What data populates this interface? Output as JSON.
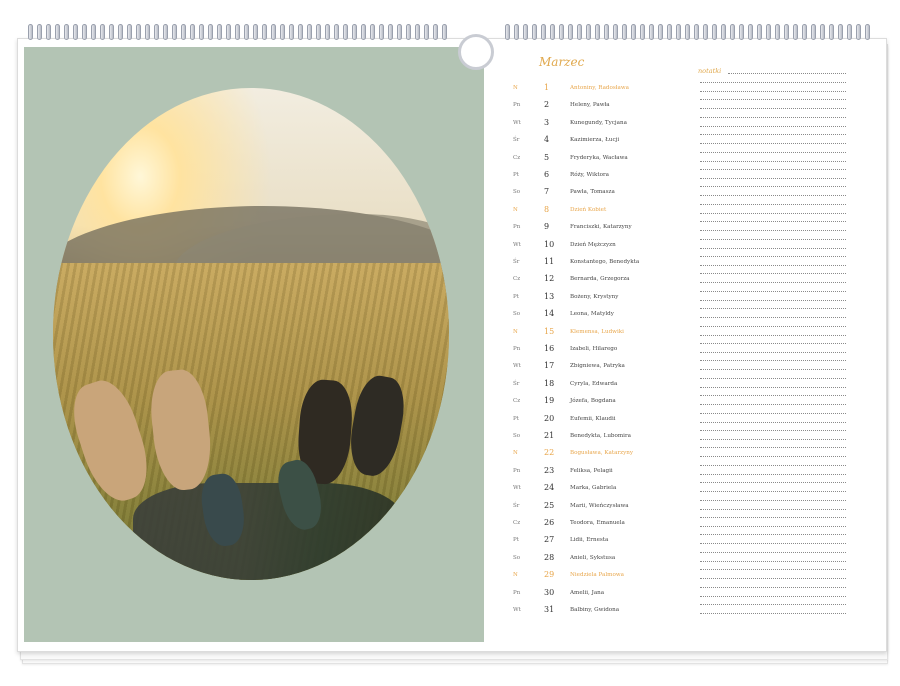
{
  "calendar": {
    "month": "Marzec",
    "notes_label": "notatki",
    "days": [
      {
        "dow": "N",
        "day": "1",
        "names": "Antoniny, Radosława",
        "sunday": true
      },
      {
        "dow": "Pn",
        "day": "2",
        "names": "Heleny, Pawła",
        "sunday": false
      },
      {
        "dow": "Wt",
        "day": "3",
        "names": "Kunegundy, Tycjana",
        "sunday": false
      },
      {
        "dow": "Śr",
        "day": "4",
        "names": "Kazimierza, Łucji",
        "sunday": false
      },
      {
        "dow": "Cz",
        "day": "5",
        "names": "Fryderyka, Wacława",
        "sunday": false
      },
      {
        "dow": "Pt",
        "day": "6",
        "names": "Róży, Wiktora",
        "sunday": false
      },
      {
        "dow": "So",
        "day": "7",
        "names": "Pawła, Tomasza",
        "sunday": false
      },
      {
        "dow": "N",
        "day": "8",
        "names": "Dzień Kobiet",
        "sunday": true
      },
      {
        "dow": "Pn",
        "day": "9",
        "names": "Franciszki, Katarzyny",
        "sunday": false
      },
      {
        "dow": "Wt",
        "day": "10",
        "names": "Dzień Mężczyzn",
        "sunday": false
      },
      {
        "dow": "Śr",
        "day": "11",
        "names": "Konstantego, Benedykta",
        "sunday": false
      },
      {
        "dow": "Cz",
        "day": "12",
        "names": "Bernarda, Grzegorza",
        "sunday": false
      },
      {
        "dow": "Pt",
        "day": "13",
        "names": "Bożeny, Krystyny",
        "sunday": false
      },
      {
        "dow": "So",
        "day": "14",
        "names": "Leona, Matyldy",
        "sunday": false
      },
      {
        "dow": "N",
        "day": "15",
        "names": "Klemensa, Ludwiki",
        "sunday": true
      },
      {
        "dow": "Pn",
        "day": "16",
        "names": "Izabeli, Hilarego",
        "sunday": false
      },
      {
        "dow": "Wt",
        "day": "17",
        "names": "Zbigniewa, Patryka",
        "sunday": false
      },
      {
        "dow": "Śr",
        "day": "18",
        "names": "Cyryla, Edwarda",
        "sunday": false
      },
      {
        "dow": "Cz",
        "day": "19",
        "names": "Józefa, Bogdana",
        "sunday": false
      },
      {
        "dow": "Pt",
        "day": "20",
        "names": "Eufemii, Klaudii",
        "sunday": false
      },
      {
        "dow": "So",
        "day": "21",
        "names": "Benedykta, Lubomira",
        "sunday": false
      },
      {
        "dow": "N",
        "day": "22",
        "names": "Bogusława, Katarzyny",
        "sunday": true
      },
      {
        "dow": "Pn",
        "day": "23",
        "names": "Feliksa, Pelagii",
        "sunday": false
      },
      {
        "dow": "Wt",
        "day": "24",
        "names": "Marka, Gabriela",
        "sunday": false
      },
      {
        "dow": "Śr",
        "day": "25",
        "names": "Marii, Wieńczysława",
        "sunday": false
      },
      {
        "dow": "Cz",
        "day": "26",
        "names": "Teodora, Emanuela",
        "sunday": false
      },
      {
        "dow": "Pt",
        "day": "27",
        "names": "Lidii, Ernesta",
        "sunday": false
      },
      {
        "dow": "So",
        "day": "28",
        "names": "Anieli, Sykstusa",
        "sunday": false
      },
      {
        "dow": "N",
        "day": "29",
        "names": "Niedziela Palmowa",
        "sunday": true
      },
      {
        "dow": "Pn",
        "day": "30",
        "names": "Amelii, Jana",
        "sunday": false
      },
      {
        "dow": "Wt",
        "day": "31",
        "names": "Balbiny, Gwidona",
        "sunday": false
      }
    ]
  },
  "colors": {
    "accent": "#e0a84c",
    "photo_background": "#b3c4b4"
  }
}
